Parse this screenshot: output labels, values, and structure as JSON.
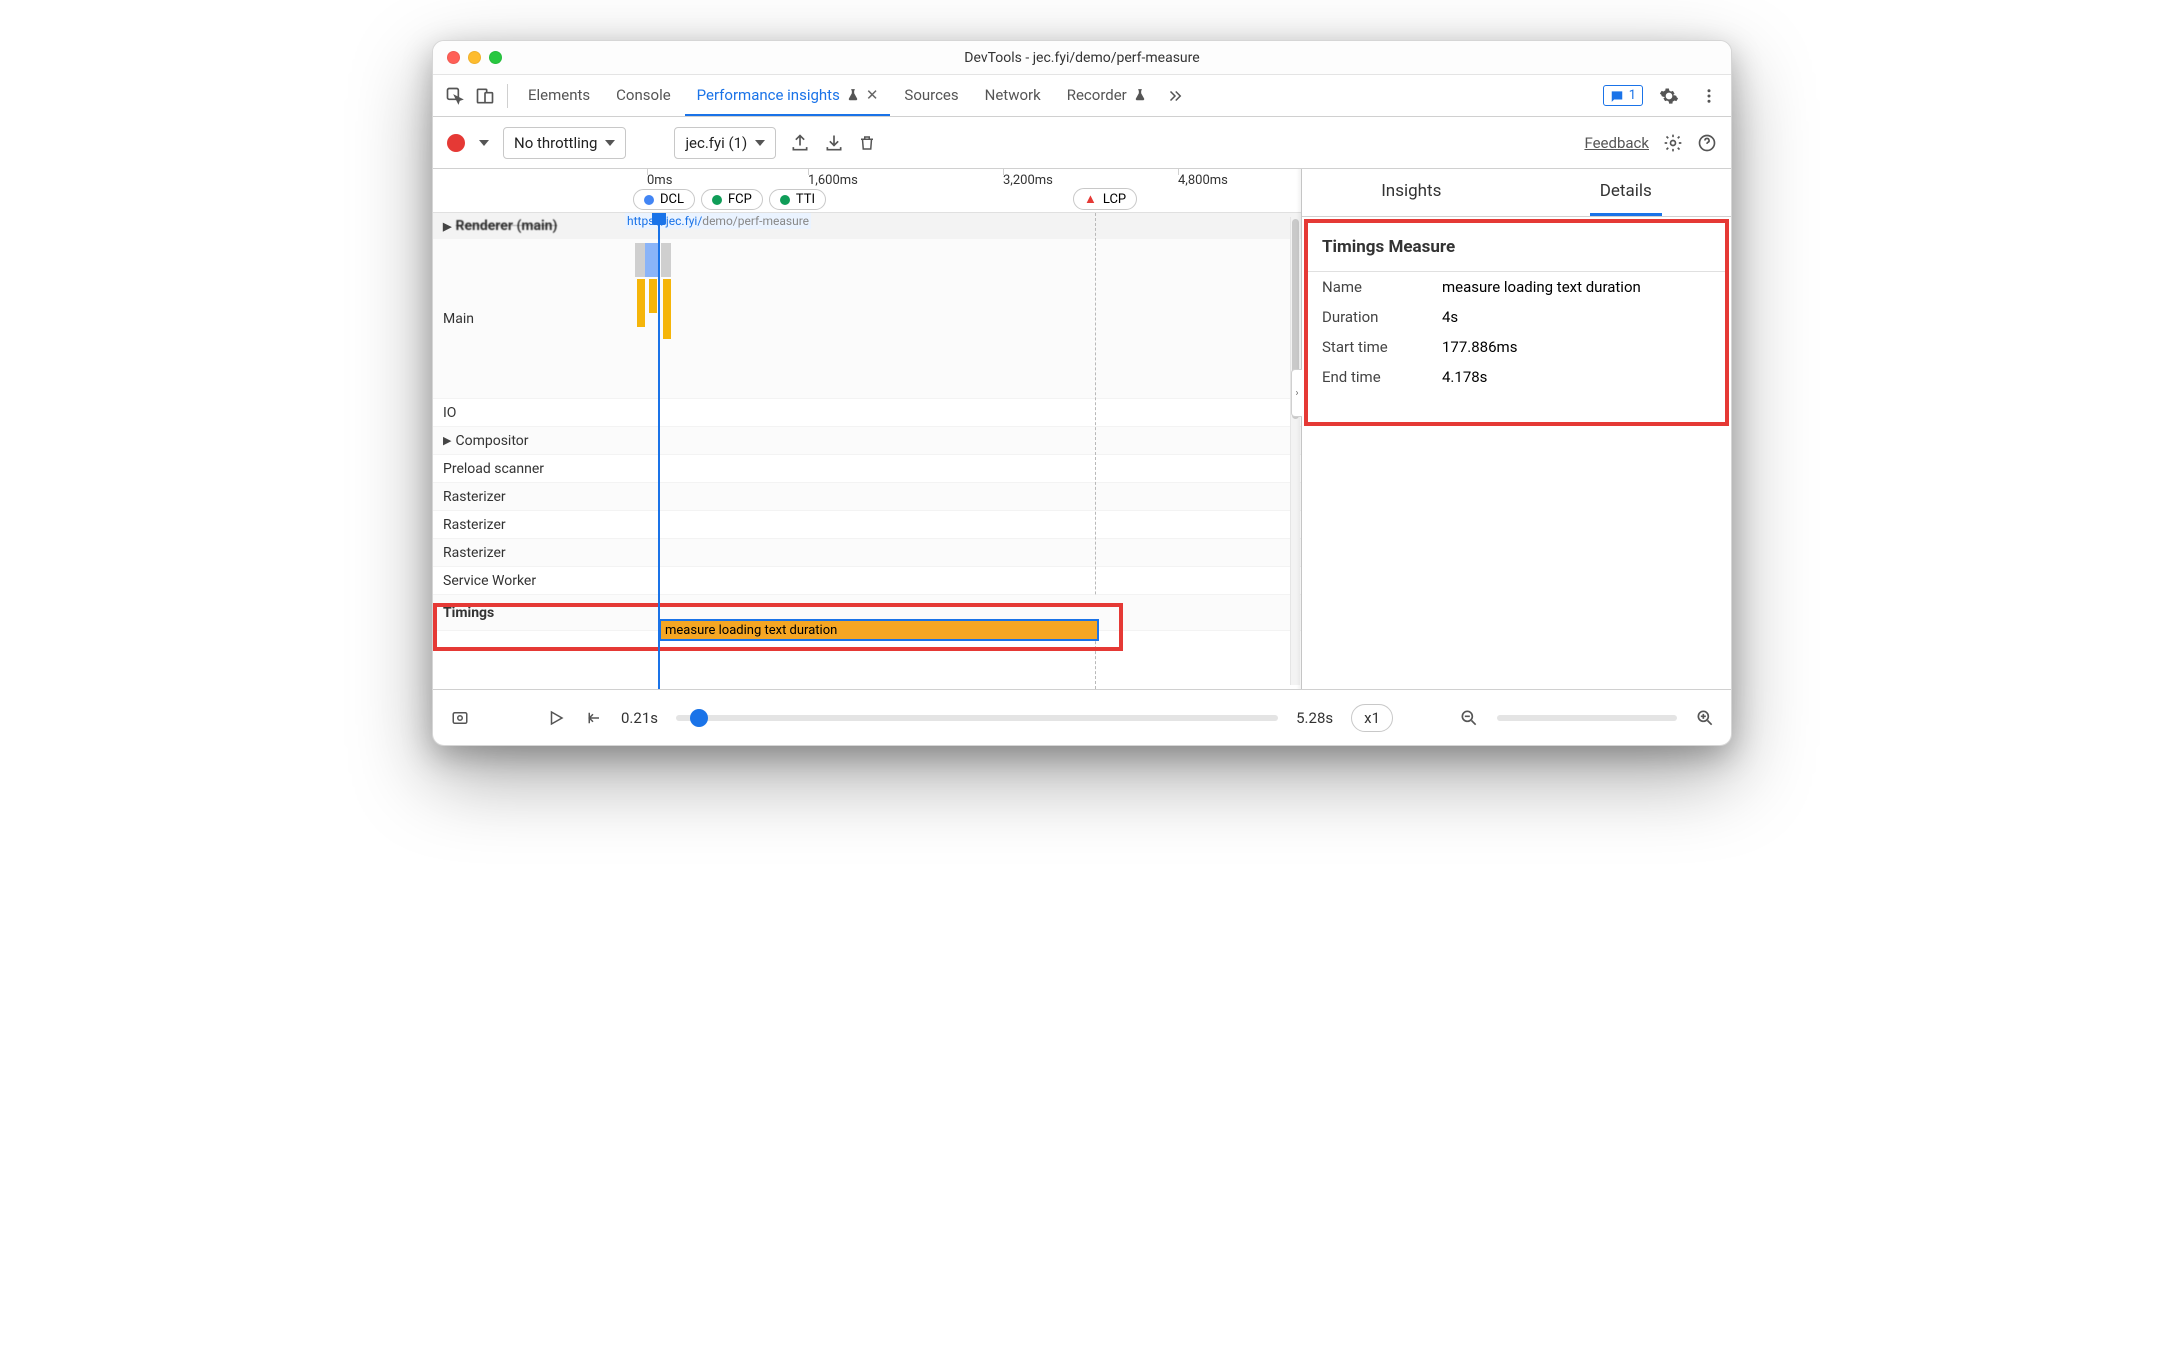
{
  "window": {
    "title": "DevTools - jec.fyi/demo/perf-measure"
  },
  "tabs": {
    "elements": "Elements",
    "console": "Console",
    "perf": "Performance insights",
    "sources": "Sources",
    "network": "Network",
    "recorder": "Recorder",
    "issues_count": "1"
  },
  "toolbar": {
    "throttle": "No throttling",
    "recording": "jec.fyi (1)",
    "feedback": "Feedback"
  },
  "ruler": {
    "t0": "0ms",
    "t1": "1,600ms",
    "t2": "3,200ms",
    "t3": "4,800ms",
    "dcl": "DCL",
    "fcp": "FCP",
    "tti": "TTI",
    "lcp": "LCP"
  },
  "tracks": {
    "renderer": "Renderer (main)",
    "main": "Main",
    "url_a": "https://jec.fyi/",
    "url_b": "demo/perf-measure",
    "io": "IO",
    "compositor": "Compositor",
    "preload": "Preload scanner",
    "rasterizer": "Rasterizer",
    "serviceworker": "Service Worker",
    "timings": "Timings",
    "timings_bar": "measure loading text duration"
  },
  "side": {
    "insights": "Insights",
    "details": "Details",
    "header": "Timings Measure",
    "name_k": "Name",
    "name_v": "measure loading text duration",
    "dur_k": "Duration",
    "dur_v": "4s",
    "start_k": "Start time",
    "start_v": "177.886ms",
    "end_k": "End time",
    "end_v": "4.178s"
  },
  "bottom": {
    "start": "0.21s",
    "end": "5.28s",
    "speed": "x1"
  }
}
